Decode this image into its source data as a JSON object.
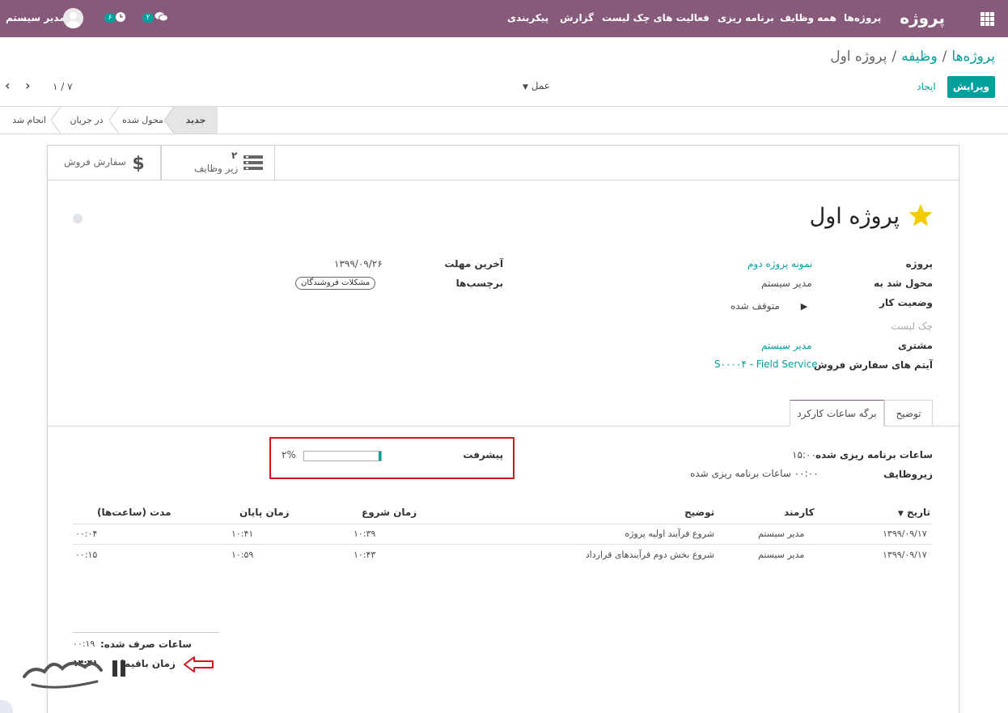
{
  "navbar": {
    "brand": "پروژه",
    "menu": [
      "پروژه‌ها",
      "همه وظایف",
      "برنامه ریزی",
      "فعالیت های چک لیست",
      "گزارش",
      "پیکربندی"
    ],
    "messages_count": "۲",
    "activities_count": "۶",
    "user_name": "مدیر سیستم"
  },
  "breadcrumb": {
    "items": [
      "پروژه‌ها",
      "وظیفه"
    ],
    "separator": "/",
    "active": "پروژه اول"
  },
  "toolbar": {
    "edit_label": "ویرایش",
    "create_label": "ایجاد",
    "action_label": "عمل"
  },
  "pager": {
    "value": "۱ / ۷"
  },
  "statusbar": {
    "stages": [
      "جدید",
      "محول شده",
      "در جریان",
      "انجام شد"
    ],
    "active_stage": "جدید"
  },
  "stat_buttons": {
    "subtasks_count": "۲",
    "subtasks_label": "زیر وظایف",
    "sales_order_label": "سفارش فروش"
  },
  "task": {
    "title": "پروژه اول",
    "starred": true
  },
  "fields_right": {
    "project_label": "پروژه",
    "project_value": "نمونه پروژه دوم",
    "assigned_label": "محول شد به",
    "assigned_value": "مدیر سیستم",
    "kanban_state_label": "وضعیت کار",
    "kanban_state_value": "متوقف شده",
    "checklist_label": "چک لیست",
    "customer_label": "مشتری",
    "customer_value": "مدیر سیستم",
    "sale_line_label": "آیتم های سفارش فروش",
    "sale_line_value": "S۰۰۰۰۴ - Field Service"
  },
  "fields_left": {
    "deadline_label": "آخرین مهلت",
    "deadline_value": "۱۳۹۹/۰۹/۲۶",
    "tags_label": "برچسب‌ها",
    "tag": "مشکلات فروشندگان"
  },
  "tabs": {
    "description": "توضیح",
    "timesheets": "برگه ساعات کارکرد"
  },
  "timesheet_summary": {
    "planned_hours_label": "ساعات برنامه ریزی شده",
    "planned_hours_value": "۱۵:۰۰",
    "subtasks_label": "زیروظایف",
    "subtasks_planned_value": "۰۰:۰۰",
    "subtasks_planned_suffix": "ساعات برنامه ریزی شده",
    "progress_label": "پیشرفت",
    "progress_percent": 2,
    "progress_text": "۲%"
  },
  "timesheet_table": {
    "headers": [
      "تاریخ",
      "کارمند",
      "توضیح",
      "زمان شروع",
      "زمان پایان",
      "مدت (ساعت‌ها)"
    ],
    "rows": [
      [
        "۱۳۹۹/۰۹/۱۷",
        "مدیر سیستم",
        "شروع فرآیند اولیه پروژه",
        "۱۰:۳۹",
        "۱۰:۴۱",
        "۰۰:۰۴"
      ],
      [
        "۱۳۹۹/۰۹/۱۷",
        "مدیر سیستم",
        "شروع بخش دوم فرآیندهای قرارداد",
        "۱۰:۴۳",
        "۱۰:۵۹",
        "۰۰:۱۵"
      ]
    ]
  },
  "totals": {
    "spent_label": "ساعات صرف شده:",
    "spent_value": "۰۰:۱۹",
    "remaining_label": "زمان باقیما",
    "remaining_value": "۱۴:۴۱"
  },
  "colors": {
    "navbar": "#875a7b",
    "accent": "#00a09d",
    "highlight_border": "#d6141f"
  },
  "watermark_text": "شهرگستر"
}
